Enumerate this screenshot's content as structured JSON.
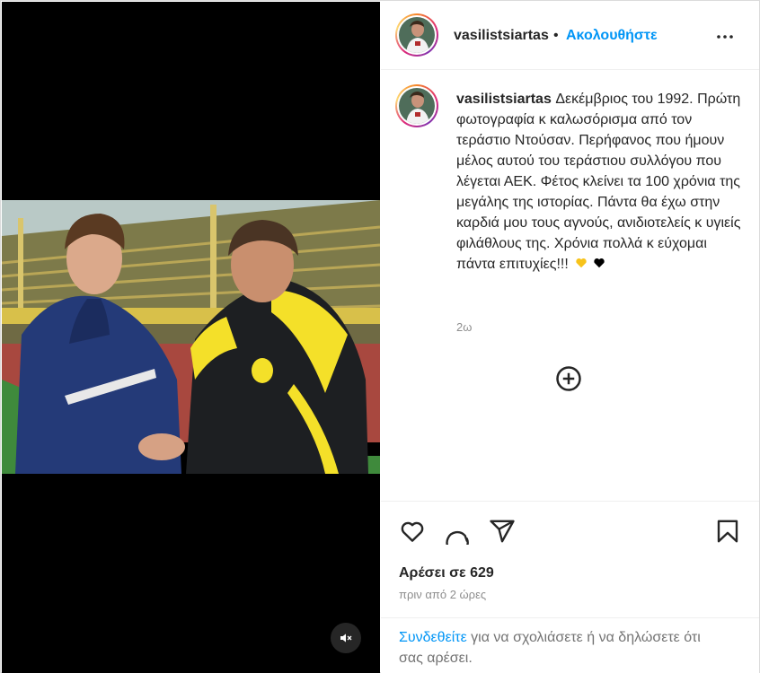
{
  "post": {
    "author": {
      "username": "vasilistsiartas",
      "separator": "•",
      "follow_label": "Ακολουθήστε",
      "more_icon": "more-horizontal-icon"
    },
    "caption": {
      "username": "vasilistsiartas",
      "text": "Δεκέμβριος του 1992. Πρώτη φωτογραφία κ καλωσόρισμα από τον τεράστιο Ντούσαν. Περήφανος που ήμουν μέλος αυτού του τεράστιου συλλόγου που λέγεται ΑΕΚ. Φέτος κλείνει τα 100 χρόνια της μεγάλης της ιστορίας. Πάντα θα έχω στην καρδιά μου τους αγνούς, ανιδιοτελείς κ υγιείς φιλάθλους της. Χρόνια πολλά κ εύχομαι πάντα επιτυχίες!!!",
      "emojis": [
        "yellow-heart",
        "black-heart"
      ],
      "time_ago": "2ω",
      "load_more_icon": "plus-circle-icon"
    },
    "actions": {
      "like_icon": "heart-icon",
      "comment_icon": "comment-icon",
      "share_icon": "send-icon",
      "save_icon": "bookmark-icon"
    },
    "likes_text": "Αρέσει σε 629",
    "posted_text": "πριν από 2 ώρες",
    "login_prompt": {
      "link": "Συνδεθείτε",
      "rest": " για να σχολιάσετε ή να δηλώσετε ότι σας αρέσει."
    },
    "media": {
      "mute_icon": "speaker-muted-icon"
    },
    "colors": {
      "accent": "#0095f6",
      "text": "#262626",
      "secondary": "#8e8e8e",
      "yellow_heart": "#f7c31b",
      "black_heart": "#000000"
    }
  }
}
